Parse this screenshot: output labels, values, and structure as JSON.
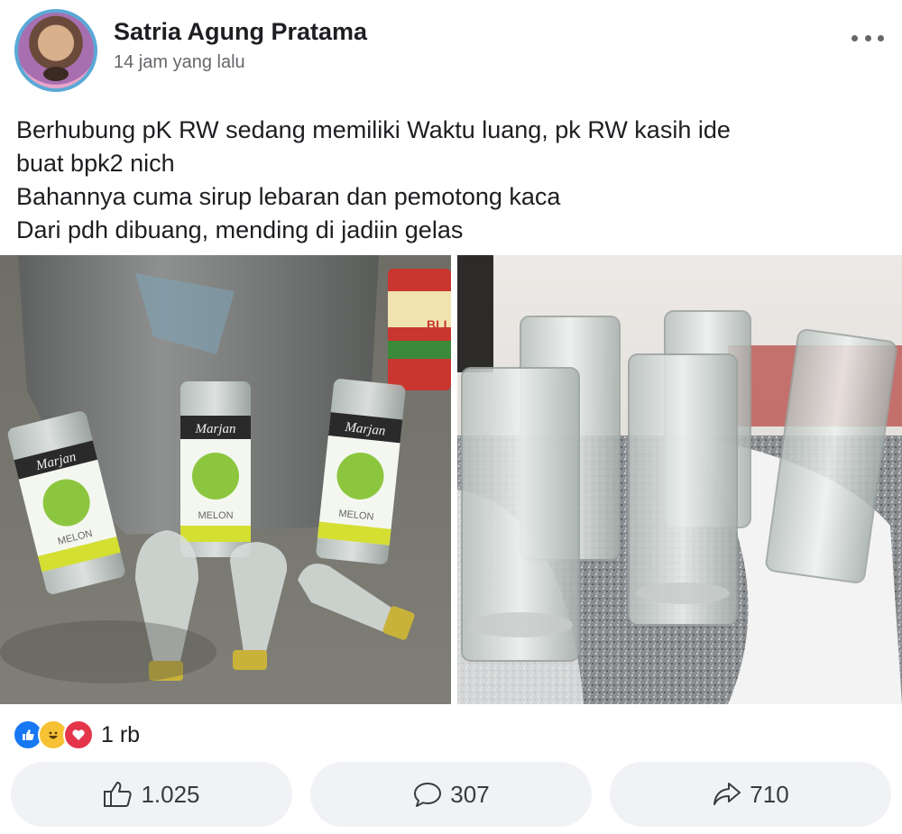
{
  "post": {
    "author_name": "Satria Agung Pratama",
    "timestamp": "14 jam yang lalu",
    "text_lines": [
      "Berhubung pK RW sedang memiliki Waktu luang, pk RW kasih ide",
      "buat bpk2 nich",
      "Bahannya cuma sirup lebaran dan pemotong kaca",
      "Dari pdh dibuang, mending di jadiin gelas"
    ],
    "left_photo": {
      "bottle_label_brand": "Marjan",
      "bottle_label_flavor": "MELON",
      "can_label": "BLI"
    }
  },
  "reactions": {
    "icons": [
      "like-icon",
      "haha-icon",
      "love-icon"
    ],
    "count": "1 rb"
  },
  "actions": {
    "like_count": "1.025",
    "comment_count": "307",
    "share_count": "710"
  },
  "colors": {
    "like": "#1877f2",
    "haha": "#f7c134",
    "love": "#e4354a",
    "button_bg": "#f0f2f5"
  }
}
